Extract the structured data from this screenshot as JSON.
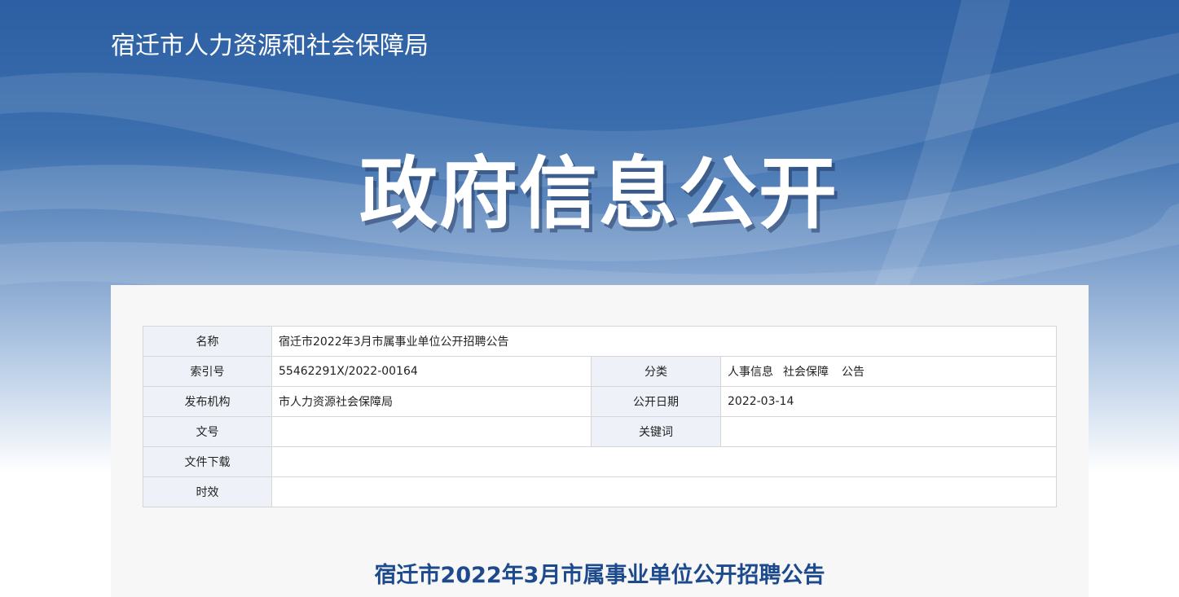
{
  "header": {
    "site_title": "宿迁市人力资源和社会保障局",
    "hero_title": "政府信息公开"
  },
  "meta": {
    "name_label": "名称",
    "name_value": "宿迁市2022年3月市属事业单位公开招聘公告",
    "index_label": "索引号",
    "index_value": "55462291X/2022-00164",
    "category_label": "分类",
    "category_values": [
      "人事信息",
      "社会保障",
      "公告"
    ],
    "publisher_label": "发布机构",
    "publisher_value": "市人力资源社会保障局",
    "date_label": "公开日期",
    "date_value": "2022-03-14",
    "docno_label": "文号",
    "docno_value": "",
    "keywords_label": "关键词",
    "keywords_value": "",
    "download_label": "文件下载",
    "download_value": "",
    "validity_label": "时效",
    "validity_value": ""
  },
  "article": {
    "title": "宿迁市2022年3月市属事业单位公开招聘公告"
  },
  "colors": {
    "banner_top": "#2c5fa3",
    "label_bg": "#eef2f8",
    "title_blue": "#1d4a8c",
    "panel_bg": "#f7f7f7"
  }
}
